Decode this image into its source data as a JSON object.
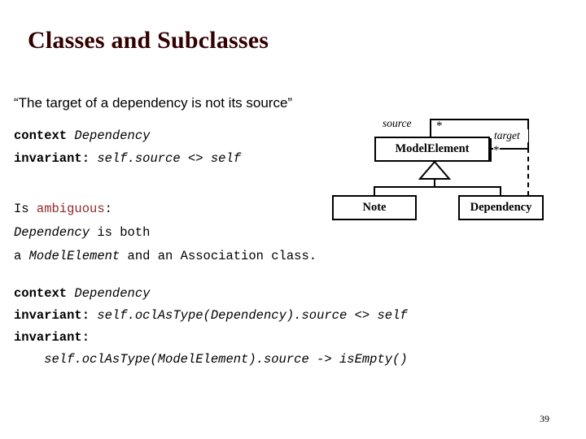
{
  "slide": {
    "title": "Classes and Subclasses",
    "page_number": "39",
    "title_color": "#330000",
    "accent_color": "#8f2b2b"
  },
  "quote": {
    "text": "“The target of a dependency is not its source”"
  },
  "ocl_block_1": {
    "line1_keyword": "context ",
    "line1_type": "Dependency",
    "line2_keyword": "invariant: ",
    "line2_expr": "self.source <> self"
  },
  "ocl_block_2": {
    "line1_prefix": "Is ",
    "line1_highlight": "ambiguous",
    "line1_suffix": ":",
    "line2_type": "Dependency",
    "line2_rest": " is both",
    "line3_prefix": "a ",
    "line3_type": "ModelElement",
    "line3_rest": " and an Association class."
  },
  "ocl_block_3": {
    "line1_keyword": "context ",
    "line1_type": "Dependency",
    "line2_keyword": "invariant: ",
    "line2_expr": "self.oclAsType(Dependency).source <> self",
    "line3_keyword": "invariant:",
    "line4_expr": "    self.oclAsType(ModelElement).source -> isEmpty()"
  },
  "diagram": {
    "classes": [
      {
        "name": "ModelElement"
      },
      {
        "name": "Note"
      },
      {
        "name": "Dependency"
      }
    ],
    "association": {
      "role_source": "source",
      "multiplicity_source": "*",
      "role_target": "target",
      "multiplicity_target": "*"
    }
  }
}
